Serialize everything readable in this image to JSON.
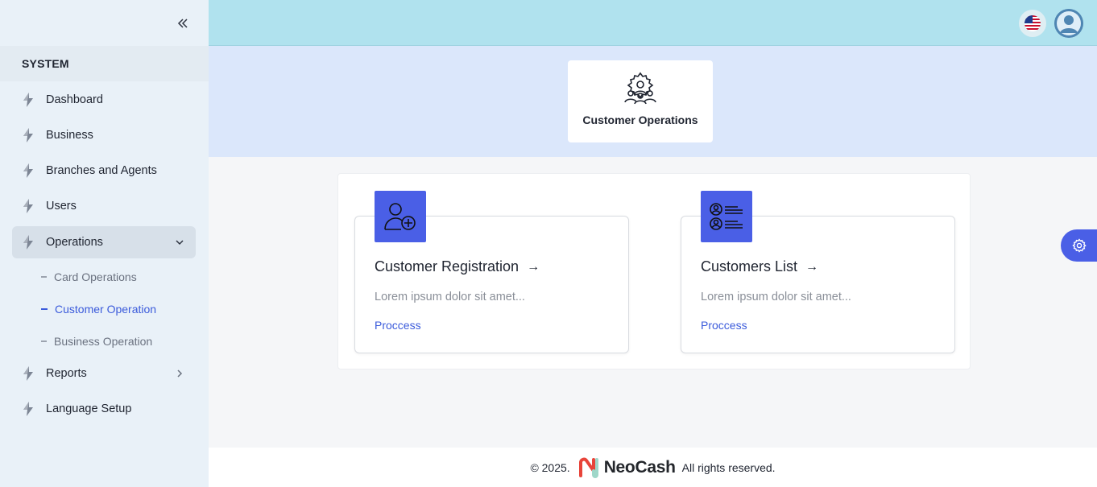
{
  "sidebar": {
    "section_title": "SYSTEM",
    "items": [
      {
        "label": "Dashboard"
      },
      {
        "label": "Business"
      },
      {
        "label": "Branches and Agents"
      },
      {
        "label": "Users"
      },
      {
        "label": "Operations"
      },
      {
        "label": "Reports"
      },
      {
        "label": "Language Setup"
      }
    ],
    "operations_sub": [
      {
        "label": "Card Operations"
      },
      {
        "label": "Customer Operation"
      },
      {
        "label": "Business Operation"
      }
    ]
  },
  "header": {
    "operation_card_label": "Customer Operations"
  },
  "cards": [
    {
      "title": "Customer Registration",
      "arrow": "→",
      "description": "Lorem ipsum dolor sit amet...",
      "link": "Proccess"
    },
    {
      "title": "Customers List",
      "arrow": "→",
      "description": "Lorem ipsum dolor sit amet...",
      "link": "Proccess"
    }
  ],
  "footer": {
    "copyright": "© 2025.",
    "brand": "NeoCash",
    "rights": "All rights reserved."
  },
  "colors": {
    "accent": "#4a5fe6",
    "topbar": "#b0e2ee",
    "band": "#dbe7fb",
    "sidebar": "#e9f1f8",
    "link": "#3b5bdb"
  },
  "icons": {
    "collapse": "double-chevron-left-icon",
    "nav": "bolt-icon",
    "language": "us-flag-icon",
    "avatar": "user-avatar-icon",
    "operations_card": "team-gear-icon",
    "registration": "add-user-icon",
    "list": "user-list-icon",
    "settings": "gear-icon"
  }
}
